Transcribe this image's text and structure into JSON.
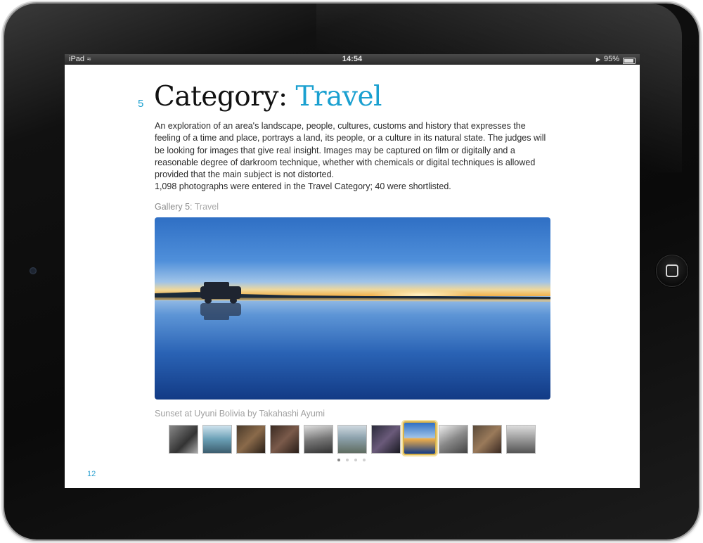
{
  "statusbar": {
    "device": "iPad",
    "time": "14:54",
    "battery": "95%",
    "battery_level": 0.95
  },
  "page": {
    "chapter_number": "5",
    "heading_prefix": "Category:",
    "heading_accent": "Travel",
    "description": [
      "An exploration of an area's landscape, people, cultures, customs and history that expresses the feeling of a time and place, portrays a land, its people, or a culture in its natural state. The judges will be looking for images that give real insight. Images may be captured on film or digitally and a reasonable degree of darkroom technique, whether with chemicals or digital techniques is allowed provided that the main subject is not distorted.",
      "1,098 photographs were entered in the Travel Category; 40 were shortlisted."
    ],
    "gallery_label": "Gallery 5:",
    "gallery_name": "Travel",
    "caption": "Sunset at Uyuni Bolivia by Takahashi Ayumi",
    "page_number": "12"
  },
  "gallery": {
    "thumbnails": [
      {
        "name": "thumb-portrait-women"
      },
      {
        "name": "thumb-glacier-landscape"
      },
      {
        "name": "thumb-market-vendor"
      },
      {
        "name": "thumb-child-portrait"
      },
      {
        "name": "thumb-desert-dunes"
      },
      {
        "name": "thumb-mountain-lake"
      },
      {
        "name": "thumb-street-crowd"
      },
      {
        "name": "thumb-sunset-uyuni",
        "selected": true
      },
      {
        "name": "thumb-mountain-bw"
      },
      {
        "name": "thumb-street-vendors"
      },
      {
        "name": "thumb-station-bw"
      }
    ],
    "pages_total": 4,
    "current_page": 1
  },
  "colors": {
    "accent": "#1aa0d0",
    "selected_thumb_border": "#d8b24a",
    "bezel": "#0e0e0e"
  }
}
